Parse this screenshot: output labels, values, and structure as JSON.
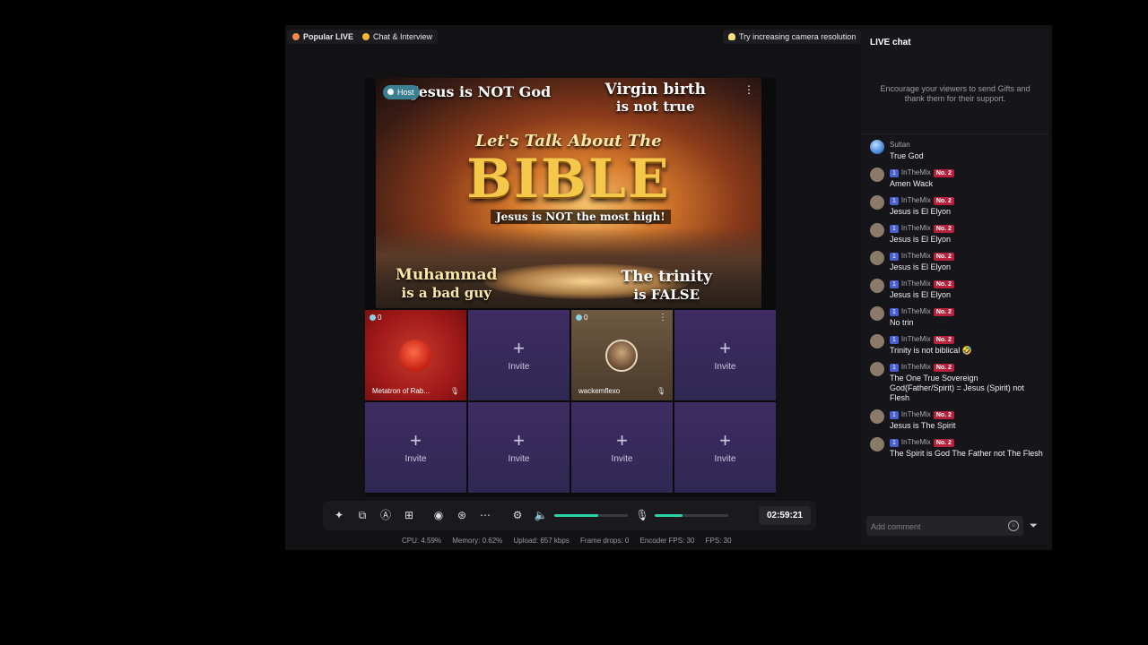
{
  "topbar": {
    "popular_live": "Popular LIVE",
    "chat_interview": "Chat & Interview",
    "tip": "Try increasing camera resolution"
  },
  "stage": {
    "host_badge": "Host",
    "banner": {
      "text_left": "Jesus is NOT God",
      "text_right_1": "Virgin birth",
      "text_right_2": "is not true",
      "talk": "Let's Talk About The",
      "bible": "BIBLE",
      "sub": "Jesus is NOT the most high!",
      "bottom_left_1": "Muhammad",
      "bottom_left_2": "is a bad guy",
      "bottom_right_1": "The trinity",
      "bottom_right_2": "is FALSE"
    },
    "guests": [
      {
        "count": "0",
        "name": "Metatron of Rab..."
      },
      {
        "count": "0",
        "name": "wackemflexo"
      }
    ],
    "invite_label": "Invite",
    "plus": "+"
  },
  "controls": {
    "timer": "02:59:21",
    "volume_level": 0.6,
    "mic_level": 0.38
  },
  "stats": {
    "cpu": "CPU: 4.59%",
    "memory": "Memory: 0.62%",
    "upload": "Upload: 657 kbps",
    "frame_drops": "Frame drops: 0",
    "encoder_fps": "Encoder FPS: 30",
    "fps": "FPS: 30"
  },
  "chat": {
    "title": "LIVE chat",
    "encourage": "Encourage your viewers to send Gifts and thank them for their support.",
    "comment_placeholder": "Add comment",
    "messages": [
      {
        "user": "Sultan",
        "level": "",
        "rank": "",
        "text": "True God"
      },
      {
        "user": "InTheMix",
        "level": "1",
        "rank": "No. 2",
        "text": "Amen Wack"
      },
      {
        "user": "InTheMix",
        "level": "1",
        "rank": "No. 2",
        "text": "Jesus is El Elyon"
      },
      {
        "user": "InTheMix",
        "level": "1",
        "rank": "No. 2",
        "text": "Jesus is El Elyon"
      },
      {
        "user": "InTheMix",
        "level": "1",
        "rank": "No. 2",
        "text": "Jesus is El Elyon"
      },
      {
        "user": "InTheMix",
        "level": "1",
        "rank": "No. 2",
        "text": "Jesus is El Elyon"
      },
      {
        "user": "InTheMix",
        "level": "1",
        "rank": "No. 2",
        "text": "No trin"
      },
      {
        "user": "InTheMix",
        "level": "1",
        "rank": "No. 2",
        "text": "Trinity is not biblical 🤣"
      },
      {
        "user": "InTheMix",
        "level": "1",
        "rank": "No. 2",
        "text": "The One True Sovereign God(Father/Spirit) = Jesus (Spirit) not Flesh"
      },
      {
        "user": "InTheMix",
        "level": "1",
        "rank": "No. 2",
        "text": "Jesus is The Spirit"
      },
      {
        "user": "InTheMix",
        "level": "1",
        "rank": "No. 2",
        "text": "The Spirit is God The Father not The Flesh"
      }
    ]
  }
}
